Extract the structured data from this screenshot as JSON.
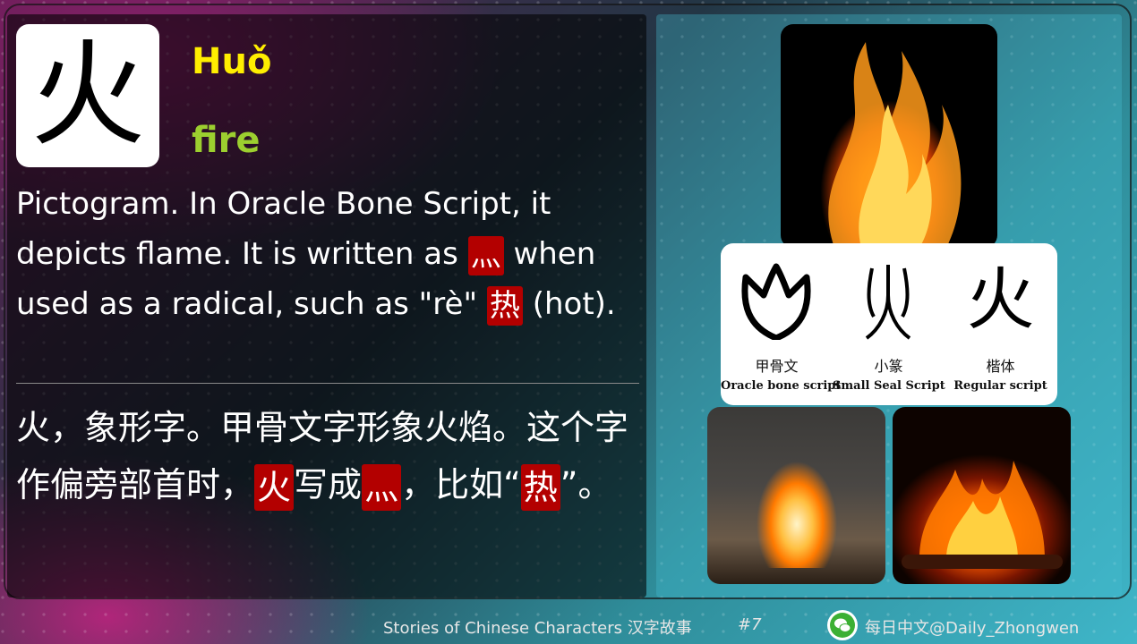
{
  "character": "火",
  "pinyin": "Huǒ",
  "meaning": "fire",
  "english_description": {
    "part1": "Pictogram. In Oracle Bone Script, it depicts flame. It is written as ",
    "radical": "灬",
    "part2": " when used as a radical, such as \"rè\" ",
    "example_char": "热",
    "part3": " (hot)."
  },
  "chinese_description": {
    "part1": "火，象形字。甲骨文字形象火焰。这个字作偏旁部首时，",
    "hl1": "火",
    "part2": "写成",
    "hl2": "灬",
    "part3": "，比如“",
    "hl3": "热",
    "part4": "”。"
  },
  "scripts": [
    {
      "zh": "甲骨文",
      "en": "Oracle bone script",
      "icon": "oracle-bone-fire-glyph"
    },
    {
      "zh": "小篆",
      "en": "Small Seal Script",
      "icon": "small-seal-fire-glyph"
    },
    {
      "zh": "楷体",
      "en": "Regular script",
      "glyph": "火"
    }
  ],
  "footer": {
    "series": "Stories of Chinese Characters 汉字故事",
    "number": "#7",
    "handle": "每日中文@Daily_Zhongwen",
    "icon": "wechat-icon"
  },
  "colors": {
    "pinyin": "#ffee00",
    "meaning": "#9ccf2f",
    "highlight": "#b30000"
  }
}
